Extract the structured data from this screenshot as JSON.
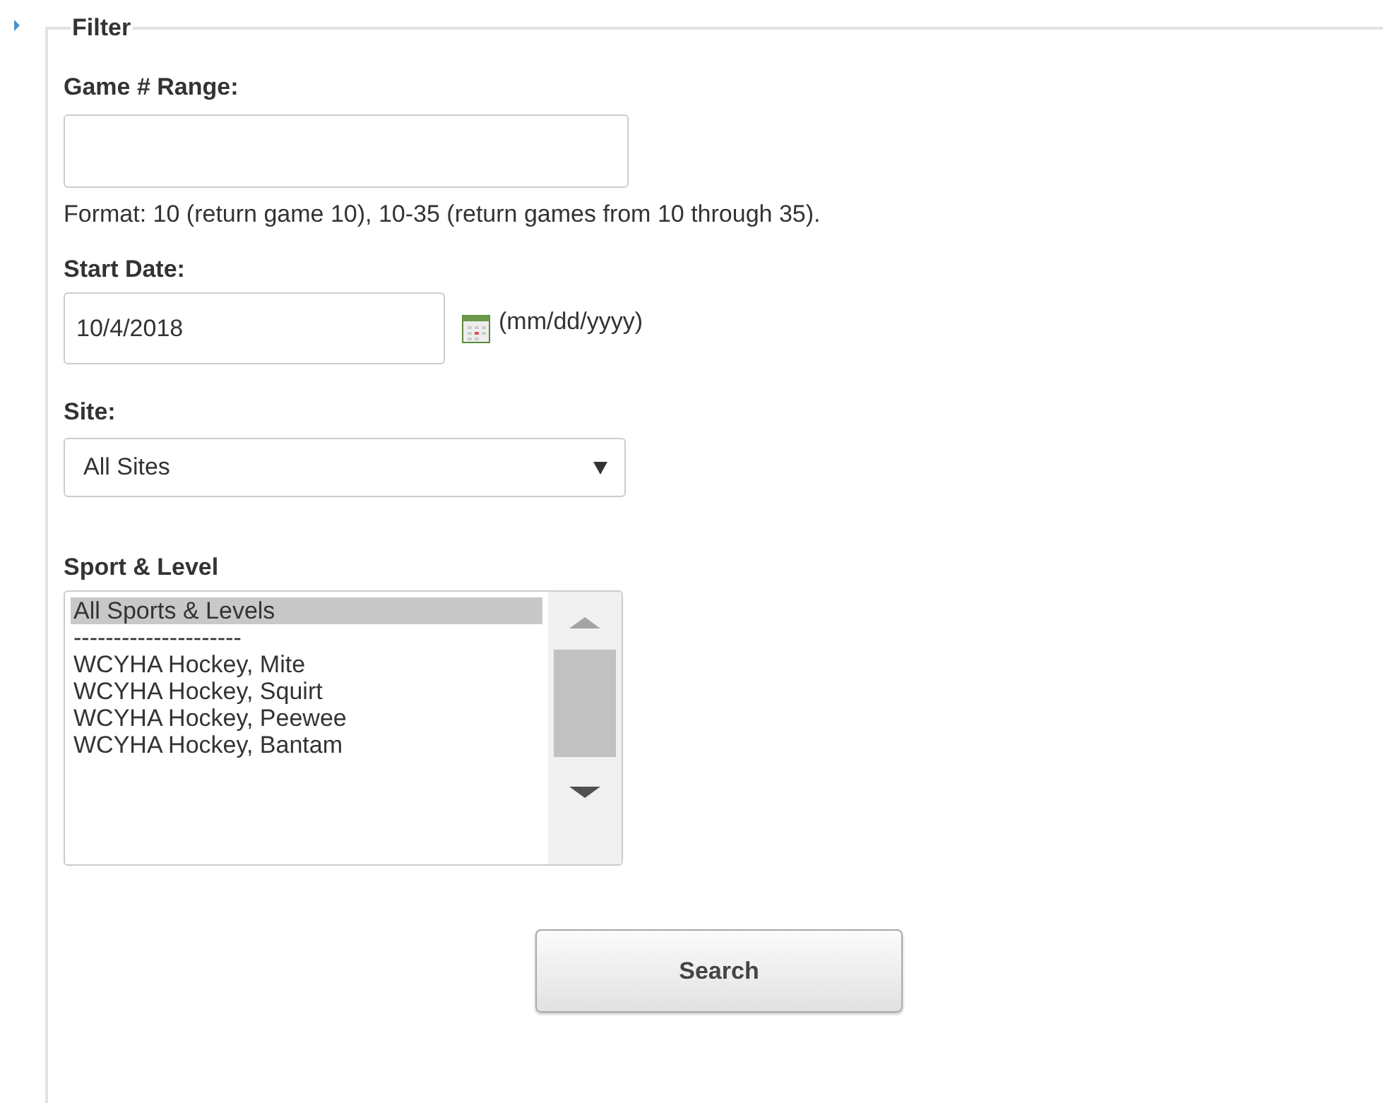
{
  "filter": {
    "legend": "Filter",
    "game_range": {
      "label": "Game # Range:",
      "hint": "Format: 10 (return game 10), 10-35 (return games from 10 through 35)."
    },
    "start_date": {
      "label": "Start Date:",
      "value": "10/4/2018",
      "format": "(mm/dd/yyyy)"
    },
    "site": {
      "label": "Site:",
      "value": "All Sites"
    },
    "sport_level": {
      "label": "Sport & Level",
      "options": [
        {
          "label": "All Sports & Levels",
          "selected": true
        },
        {
          "label": "---------------------",
          "selected": false
        },
        {
          "label": "WCYHA Hockey, Mite",
          "selected": false
        },
        {
          "label": "WCYHA Hockey, Squirt",
          "selected": false
        },
        {
          "label": "WCYHA Hockey, Peewee",
          "selected": false
        },
        {
          "label": "WCYHA Hockey, Bantam",
          "selected": false
        }
      ]
    },
    "search_button": "Search"
  }
}
